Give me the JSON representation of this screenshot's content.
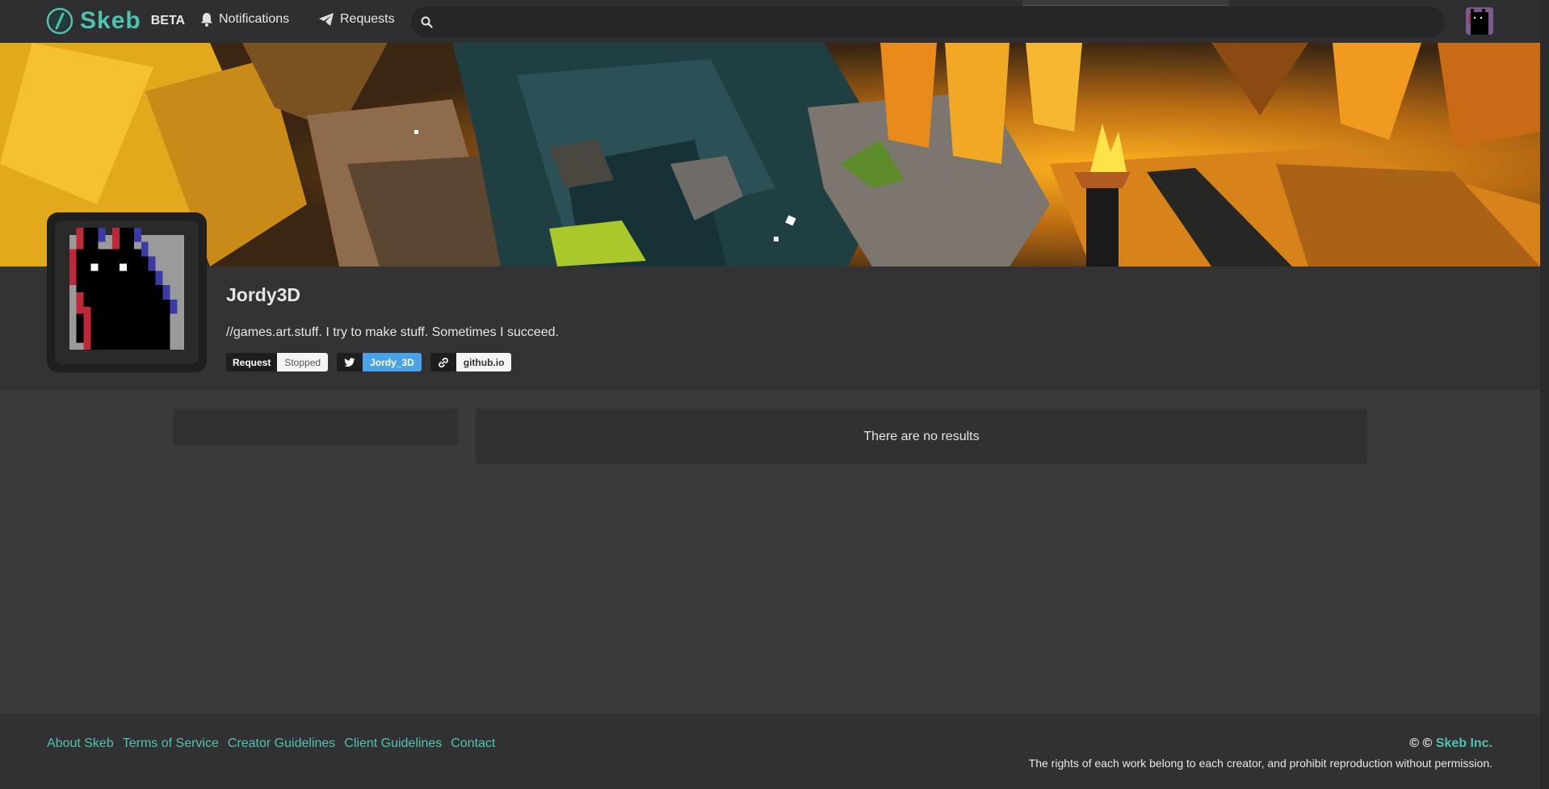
{
  "header": {
    "logo_text": "Skeb",
    "beta_label": "BETA",
    "notifications_label": "Notifications",
    "requests_label": "Requests",
    "search_placeholder": ""
  },
  "profile": {
    "username": "Jordy3D",
    "bio": "//games.art.stuff. I try to make stuff. Sometimes I succeed.",
    "tags": {
      "request_key": "Request",
      "request_value": "Stopped",
      "twitter_value": "Jordy_3D",
      "link_value": "github.io"
    }
  },
  "results": {
    "empty_message": "There are no results"
  },
  "footer": {
    "links": [
      "About Skeb",
      "Terms of Service",
      "Creator Guidelines",
      "Client Guidelines",
      "Contact"
    ],
    "copyright_prefix": "© ©",
    "copyright_brand": "Skeb Inc.",
    "rights": "The rights of each work belong to each creator, and prohibit reproduction without permission."
  },
  "colors": {
    "accent": "#4fc3b0",
    "twitter": "#4aa3e8",
    "background": "#3a3a3c"
  },
  "icons": [
    "skeb-logo-icon",
    "bell-icon",
    "paper-plane-icon",
    "search-icon",
    "twitter-icon",
    "link-icon"
  ]
}
